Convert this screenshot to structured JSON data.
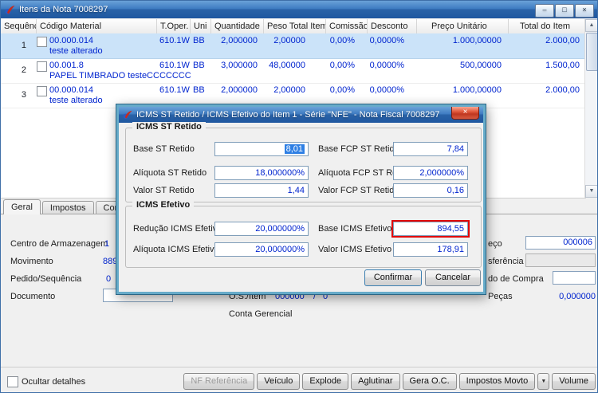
{
  "window": {
    "title": "Itens da Nota 7008297",
    "footer_checkbox": "Ocultar detalhes"
  },
  "icons": {
    "minimize": "–",
    "maximize": "□",
    "close": "×",
    "dropdown": "▼",
    "scroll_up": "▲",
    "scroll_down": "▼"
  },
  "table": {
    "columns": [
      "Sequência",
      "Código Material",
      "T.Oper.",
      "Uni",
      "Quantidade",
      "Peso Total Item",
      "Comissão",
      "Desconto",
      "Preço Unitário",
      "Total do Item"
    ],
    "rows": [
      {
        "seq": "1",
        "codigo": "00.000.014",
        "descricao": "teste alterado",
        "toper": "610.1W",
        "uni": "BB",
        "quantidade": "2,000000",
        "peso": "2,00000",
        "comissao": "0,00%",
        "desconto": "0,0000%",
        "preco": "1.000,00000",
        "total": "2.000,00"
      },
      {
        "seq": "2",
        "codigo": "00.001.8",
        "descricao": "PAPEL TIMBRADO testeCCCCCCC",
        "toper": "610.1W",
        "uni": "BB",
        "quantidade": "3,000000",
        "peso": "48,00000",
        "comissao": "0,00%",
        "desconto": "0,0000%",
        "preco": "500,00000",
        "total": "1.500,00"
      },
      {
        "seq": "3",
        "codigo": "00.000.014",
        "descricao": "teste alterado",
        "toper": "610.1W",
        "uni": "BB",
        "quantidade": "2,000000",
        "peso": "2,00000",
        "comissao": "0,00%",
        "desconto": "0,0000%",
        "preco": "1.000,00000",
        "total": "2.000,00"
      }
    ]
  },
  "tabs": [
    {
      "label": "Geral"
    },
    {
      "label": "Impostos"
    },
    {
      "label": "Complemen"
    }
  ],
  "detail": {
    "centro_label": "Centro de Armazenagem",
    "centro_value": "1",
    "movimento_label": "Movimento",
    "movimento_value": "889",
    "pedido_label": "Pedido/Sequência",
    "pedido_value": "0",
    "documento_label": "Documento",
    "os_label": "O.S./Item",
    "os_number": "000000",
    "os_separator": "/",
    "os_item": "0",
    "conta_label": "Conta Gerencial",
    "right1_label": "eço",
    "right1_value": "000006",
    "right2_label": "sferência",
    "right3_label": "do de Compra",
    "pecas_label": "Peças",
    "pecas_value": "0,000000"
  },
  "footer_buttons": {
    "nf_referencia": "NF Referência",
    "veiculo": "Veículo",
    "explode": "Explode",
    "aglutinar": "Aglutinar",
    "gera_oc": "Gera O.C.",
    "impostos_movto": "Impostos Movto",
    "volume": "Volume"
  },
  "dialog": {
    "title": "ICMS ST Retido / ICMS Efetivo do Item 1 - Série \"NFE\" - Nota Fiscal 7008297",
    "st_group": {
      "title": "ICMS ST Retido",
      "base_label": "Base ST Retido",
      "base_value": "8,01",
      "base_fcp_label": "Base FCP ST Retido",
      "base_fcp_value": "7,84",
      "aliquota_label": "Alíquota ST Retido",
      "aliquota_value": "18,000000%",
      "aliquota_fcp_label": "Alíquota FCP ST Retido",
      "aliquota_fcp_value": "2,000000%",
      "valor_label": "Valor ST Retido",
      "valor_value": "1,44",
      "valor_fcp_label": "Valor FCP ST Retido",
      "valor_fcp_value": "0,16"
    },
    "efetivo_group": {
      "title": "ICMS Efetivo",
      "reducao_label": "Redução ICMS Efetivo",
      "reducao_value": "20,000000%",
      "base_label": "Base ICMS Efetivo",
      "base_value": "894,55",
      "aliquota_label": "Alíquota ICMS Efetivo",
      "aliquota_value": "20,000000%",
      "valor_label": "Valor ICMS Efetivo",
      "valor_value": "178,91"
    },
    "confirm_label": "Confirmar",
    "cancel_label": "Cancelar"
  }
}
